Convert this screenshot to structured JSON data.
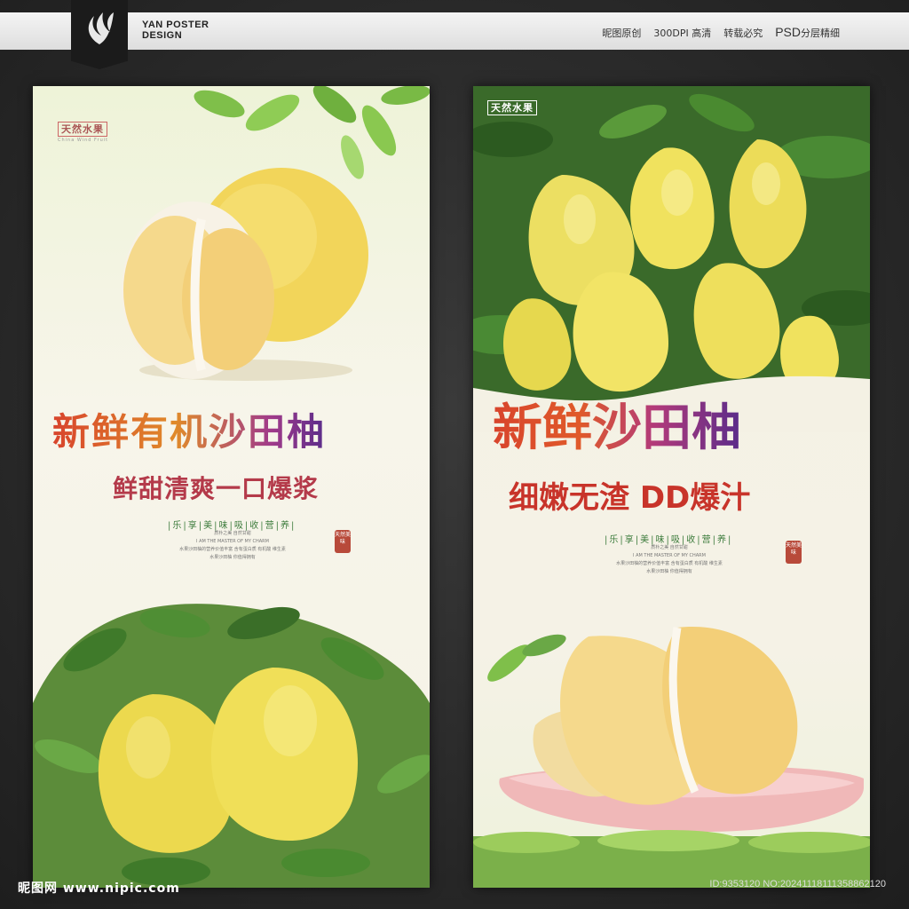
{
  "header": {
    "brand_line1": "YAN POSTER",
    "brand_line2": "DESIGN",
    "items": [
      "昵图原创",
      "300DPI 高清",
      "转载必究"
    ],
    "psd_label": "PSD",
    "psd_suffix": "分层精细"
  },
  "poster_left": {
    "badge": "天然水果",
    "badge_en": "China Wind Fruit",
    "title": "新鲜有机沙田柚",
    "subtitle": "鲜甜清爽一口爆浆",
    "tags": "|乐|享|美|味|吸|收|营|养|",
    "lines": [
      "质朴之美 自然甘甜",
      "I AM THE MASTER OF MY CHARM",
      "水果沙田柚的营养价值丰富 含有蛋白质 有机酸 维生素",
      "水果沙田柚 你值得拥有"
    ],
    "seal": "天然美味"
  },
  "poster_right": {
    "badge": "天然水果",
    "title": "新鲜沙田柚",
    "subtitle": "细嫩无渣 DD爆汁",
    "tags": "|乐|享|美|味|吸|收|营|养|",
    "lines": [
      "质朴之美 自然甘甜",
      "I AM THE MASTER OF MY CHARM",
      "水果沙田柚的营养价值丰富 含有蛋白质 有机酸 维生素",
      "水果沙田柚 你值得拥有"
    ],
    "seal": "天然美味"
  },
  "footer": {
    "site_left": "昵图网 www.nipic.com",
    "id_right": "ID:9353120 NO:20241118111358862120"
  },
  "colors": {
    "background": "#2b2b2b",
    "pomelo_yellow": "#f2d55a",
    "pulp": "#f5d98c",
    "leaf": "#4e9a3a",
    "title_red": "#d8442c",
    "title_purple": "#5a2c8a"
  }
}
